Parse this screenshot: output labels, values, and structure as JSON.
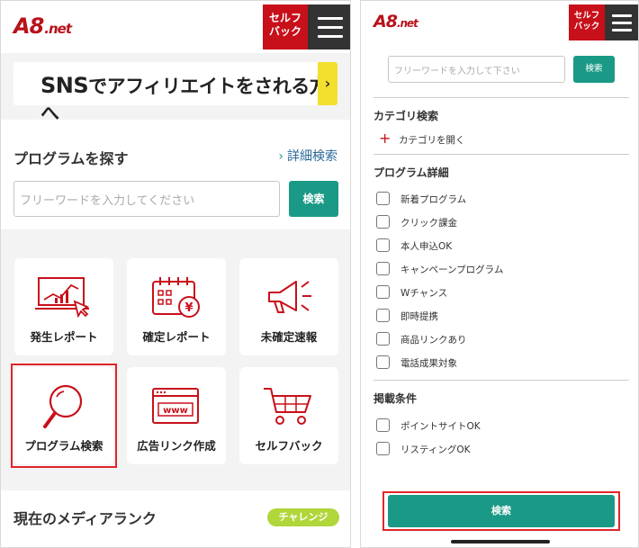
{
  "left": {
    "logo": {
      "main": "A8",
      "suffix": ".net"
    },
    "self_back": {
      "line1": "セルフ",
      "line2": "バック"
    },
    "banner": {
      "sns": "SNS",
      "rest": "でアフィリエイトをされる方へ",
      "arrow": "›"
    },
    "program_search": {
      "title": "プログラムを探す",
      "detail_link": "詳細検索",
      "detail_chevron": "›",
      "placeholder": "フリーワードを入力してください",
      "search_btn": "検索"
    },
    "tiles": [
      {
        "label": "発生レポート",
        "icon": "chart-report-icon"
      },
      {
        "label": "確定レポート",
        "icon": "calendar-yen-icon"
      },
      {
        "label": "未確定速報",
        "icon": "megaphone-icon"
      },
      {
        "label": "プログラム検索",
        "icon": "magnifier-icon",
        "highlighted": true
      },
      {
        "label": "広告リンク作成",
        "icon": "www-browser-icon"
      },
      {
        "label": "セルフバック",
        "icon": "shopping-cart-icon"
      }
    ],
    "rank": {
      "title": "現在のメディアランク",
      "badge": "チャレンジ"
    }
  },
  "right": {
    "logo": {
      "main": "A8",
      "suffix": ".net"
    },
    "self_back": {
      "line1": "セルフ",
      "line2": "バック"
    },
    "search": {
      "placeholder": "フリーワードを入力して下さい",
      "button": "検索"
    },
    "category": {
      "title": "カテゴリ検索",
      "plus": "+",
      "open": "カテゴリを開く"
    },
    "details": {
      "title": "プログラム詳細",
      "items": [
        "新着プログラム",
        "クリック課金",
        "本人申込OK",
        "キャンペーンプログラム",
        "Wチャンス",
        "即時提携",
        "商品リンクあり",
        "電話成果対象"
      ]
    },
    "conditions": {
      "title": "掲載条件",
      "items": [
        "ポイントサイトOK",
        "リスティングOK"
      ]
    },
    "submit": "検索"
  },
  "colors": {
    "brand_red": "#c8101a",
    "teal": "#1a9a86",
    "highlight": "#e0262a",
    "badge_green": "#b0d63a",
    "banner_yellow": "#f3e02e"
  }
}
